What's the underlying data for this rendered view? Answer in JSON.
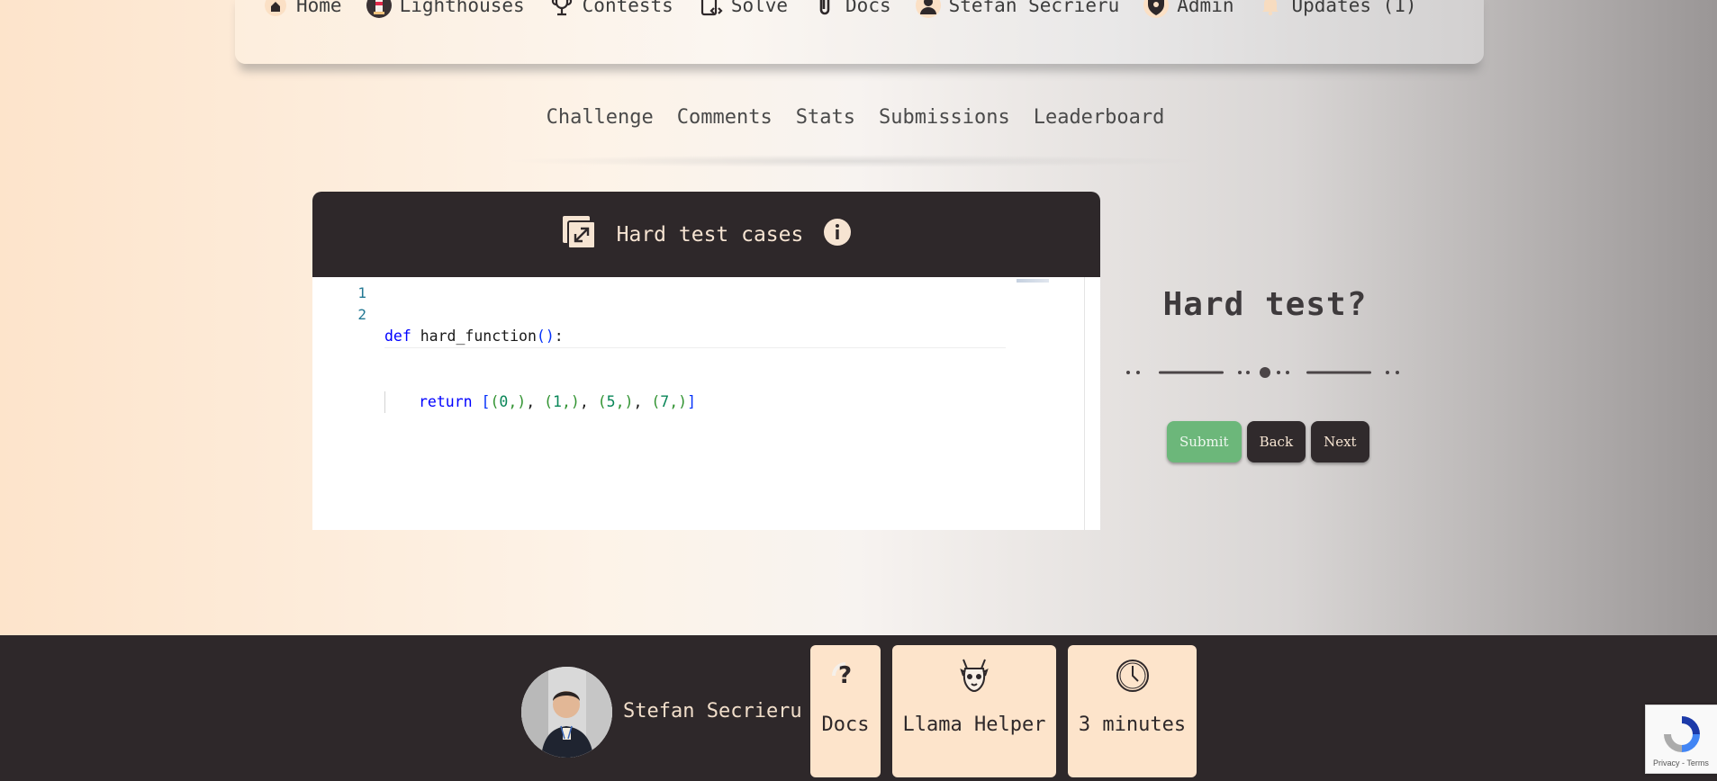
{
  "nav": {
    "items": [
      {
        "label": "Home",
        "icon": "home-icon"
      },
      {
        "label": "Lighthouses",
        "icon": "lighthouse-icon"
      },
      {
        "label": "Contests",
        "icon": "trophy-icon"
      },
      {
        "label": "Solve",
        "icon": "code-clipboard-icon"
      },
      {
        "label": "Docs",
        "icon": "paperclip-icon"
      },
      {
        "label": "Stefan Secrieru",
        "icon": "user-icon"
      },
      {
        "label": "Admin",
        "icon": "admin-shield-icon"
      },
      {
        "label": "Updates (1)",
        "icon": "bell-icon"
      }
    ]
  },
  "subtabs": [
    "Challenge",
    "Comments",
    "Stats",
    "Submissions",
    "Leaderboard"
  ],
  "editor": {
    "title": "Hard test cases",
    "expand_icon": "expand-icon",
    "info_icon": "info-icon",
    "line_numbers": [
      "1",
      "2"
    ],
    "code": {
      "l1_kw": "def",
      "l1_name": " hard_function",
      "l1_parens": "()",
      "l1_colon": ":",
      "l2_kw": "return",
      "l2_open": "[",
      "t1": "(",
      "n0": "0",
      "t1c": ",)",
      "sep1": ", ",
      "t2": "(",
      "n1": "1",
      "t2c": ",)",
      "sep2": ", ",
      "t3": "(",
      "n5": "5",
      "t3c": ",)",
      "sep3": ", ",
      "t4": "(",
      "n7": "7",
      "t4c": ",)",
      "l2_close": "]"
    }
  },
  "panel": {
    "question": "Hard test?",
    "progress_step": 2,
    "progress_total": 3,
    "buttons": {
      "submit": "Submit",
      "back": "Back",
      "next": "Next"
    }
  },
  "footer": {
    "user_name": "Stefan Secrieru",
    "tiles": [
      {
        "label": "Docs",
        "icon": "question-icon"
      },
      {
        "label": "Llama Helper",
        "icon": "llama-icon"
      },
      {
        "label": "3 minutes",
        "icon": "clock-icon"
      }
    ],
    "recaptcha_text": "Privacy - Terms"
  },
  "colors": {
    "dark": "#2e282a",
    "cream": "#fde4cb",
    "submit_green": "#6cb77a"
  }
}
